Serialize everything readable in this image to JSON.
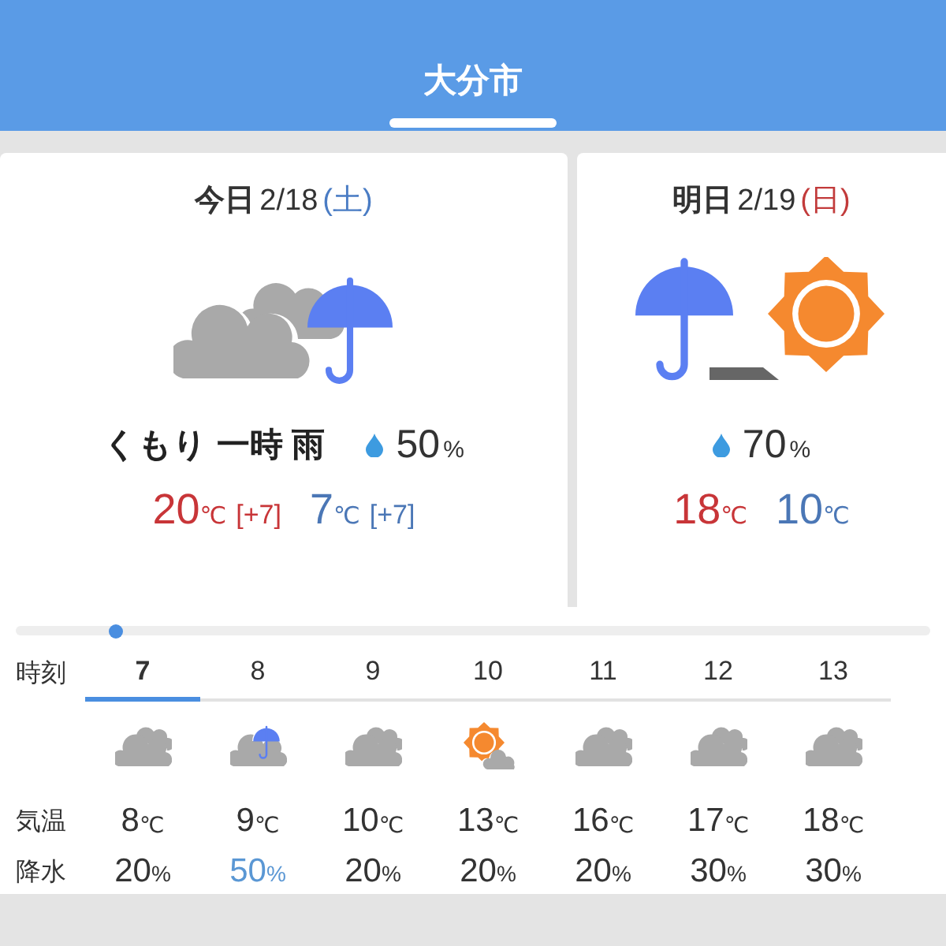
{
  "header": {
    "title": "大分市"
  },
  "days": [
    {
      "label": "今日",
      "date": "2/18",
      "weekday": {
        "text": "(土)",
        "color": "#4a7cc4"
      },
      "kind": "cloudy_then_rain",
      "weather": "くもり 一時 雨",
      "rain": "50",
      "rain_unit": "%",
      "high": "20",
      "high_unit": "℃",
      "high_diff": "[+7]",
      "low": "7",
      "low_unit": "℃",
      "low_diff": "[+7]"
    },
    {
      "label": "明日",
      "date": "2/19",
      "weekday": {
        "text": "(日)",
        "color": "#c23b3b"
      },
      "kind": "rain_then_sunny",
      "rain": "70",
      "rain_unit": "%",
      "high": "18",
      "high_unit": "℃",
      "low": "10",
      "low_unit": "℃"
    }
  ],
  "hourly": {
    "labels": {
      "time": "時刻",
      "temp": "気温",
      "rain": "降水"
    },
    "hours": [
      {
        "hour": "7",
        "kind": "cloudy",
        "temp": "8",
        "temp_unit": "℃",
        "rain": "20",
        "rain_unit": "%",
        "selected": true,
        "rain_high": false
      },
      {
        "hour": "8",
        "kind": "cloudy_rain",
        "temp": "9",
        "temp_unit": "℃",
        "rain": "50",
        "rain_unit": "%",
        "selected": false,
        "rain_high": true
      },
      {
        "hour": "9",
        "kind": "cloudy",
        "temp": "10",
        "temp_unit": "℃",
        "rain": "20",
        "rain_unit": "%",
        "selected": false,
        "rain_high": false
      },
      {
        "hour": "10",
        "kind": "sunny_cloudy",
        "temp": "13",
        "temp_unit": "℃",
        "rain": "20",
        "rain_unit": "%",
        "selected": false,
        "rain_high": false
      },
      {
        "hour": "11",
        "kind": "cloudy",
        "temp": "16",
        "temp_unit": "℃",
        "rain": "20",
        "rain_unit": "%",
        "selected": false,
        "rain_high": false
      },
      {
        "hour": "12",
        "kind": "cloudy",
        "temp": "17",
        "temp_unit": "℃",
        "rain": "30",
        "rain_unit": "%",
        "selected": false,
        "rain_high": false
      },
      {
        "hour": "13",
        "kind": "cloudy",
        "temp": "18",
        "temp_unit": "℃",
        "rain": "30",
        "rain_unit": "%",
        "selected": false,
        "rain_high": false
      }
    ]
  }
}
